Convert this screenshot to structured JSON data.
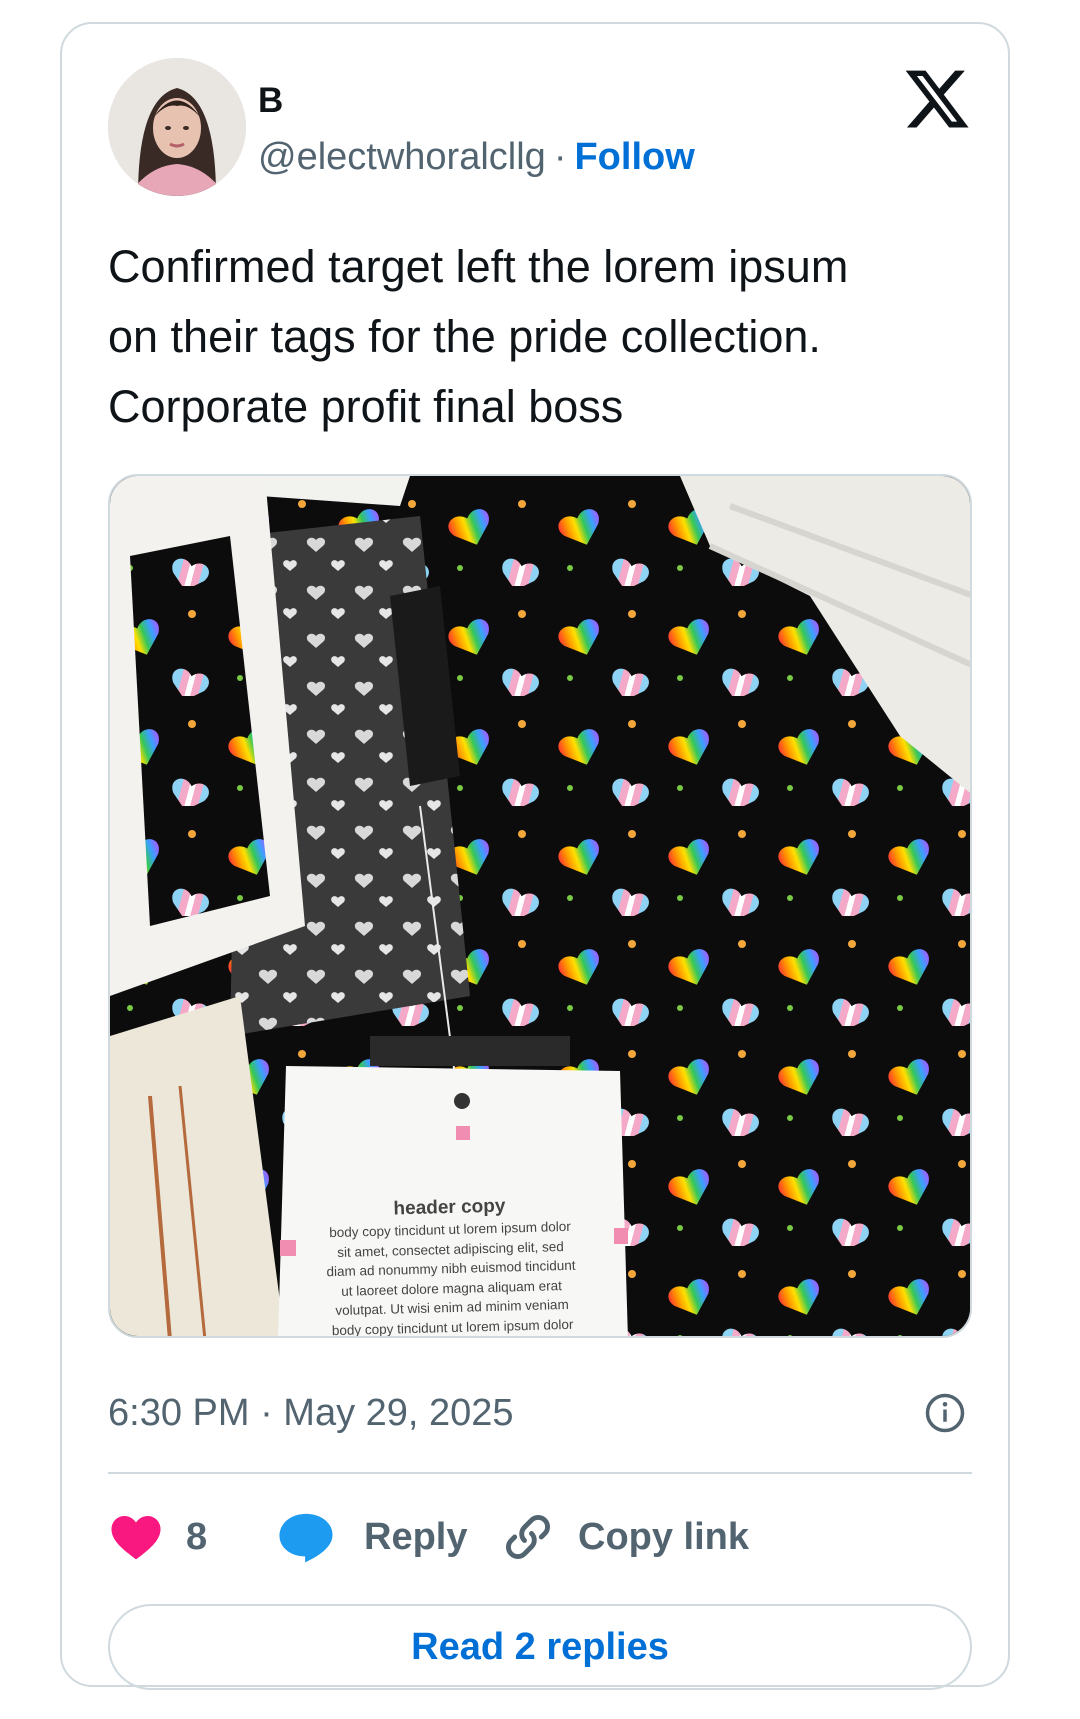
{
  "author": {
    "display_name": "B",
    "handle": "@electwhoralcllg",
    "separator": "·",
    "follow_label": "Follow"
  },
  "brand_icon": "x-logo-icon",
  "tweet": {
    "text_lines": [
      "Confirmed target left the lorem ipsum",
      "on their tags for the pride collection.",
      "Corporate profit final boss"
    ],
    "timestamp": "6:30 PM · May 29, 2025"
  },
  "media": {
    "tag": {
      "header": "header copy",
      "body_lines": [
        "body copy tincidunt ut lorem ipsum dolor",
        "sit amet, consectet adipiscing elit, sed",
        "diam ad nonummy nibh euismod tincidunt",
        "ut laoreet dolore magna aliquam erat",
        "volutpat. Ut wisi enim ad minim veniam",
        "body copy tincidunt ut lorem ipsum dolor"
      ]
    }
  },
  "actions": {
    "like_count": "8",
    "reply_label": "Reply",
    "copy_link_label": "Copy link"
  },
  "read_replies_label": "Read 2 replies",
  "colors": {
    "link_blue": "#006fd6",
    "like_pink": "#f91880",
    "reply_blue": "#1d9bf0",
    "muted": "#536471",
    "border": "#cfd9de"
  }
}
